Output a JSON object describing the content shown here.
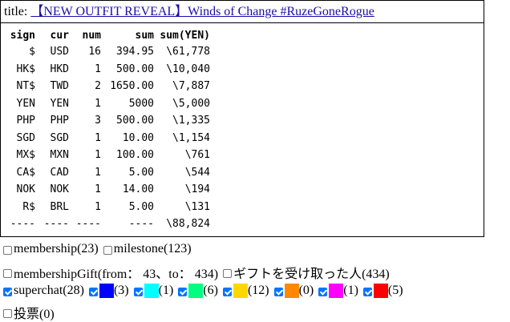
{
  "title": {
    "label": "title:",
    "link_text": "【NEW OUTFIT REVEAL】Winds of Change #RuzeGoneRogue"
  },
  "table": {
    "headers": [
      "sign",
      "cur",
      "num",
      "sum",
      "sum(YEN)"
    ],
    "rows": [
      [
        "$",
        "USD",
        "16",
        "394.95",
        "\\61,778"
      ],
      [
        "HK$",
        "HKD",
        "1",
        "500.00",
        "\\10,040"
      ],
      [
        "NT$",
        "TWD",
        "2",
        "1650.00",
        "\\7,887"
      ],
      [
        "YEN",
        "YEN",
        "1",
        "5000",
        "\\5,000"
      ],
      [
        "PHP",
        "PHP",
        "3",
        "500.00",
        "\\1,335"
      ],
      [
        "SGD",
        "SGD",
        "1",
        "10.00",
        "\\1,154"
      ],
      [
        "MX$",
        "MXN",
        "1",
        "100.00",
        "\\761"
      ],
      [
        "CA$",
        "CAD",
        "1",
        "5.00",
        "\\544"
      ],
      [
        "NOK",
        "NOK",
        "1",
        "14.00",
        "\\194"
      ],
      [
        "R$",
        "BRL",
        "1",
        "5.00",
        "\\131"
      ],
      [
        "----",
        "----",
        "----",
        "----",
        "\\88,824"
      ]
    ]
  },
  "filters": {
    "membership": "membership(23)",
    "milestone": "milestone(123)",
    "membership_gift": "membershipGift(from： 43、to： 434)",
    "gift_received": "ギフトを受け取った人(434)",
    "superchat": "superchat(28)",
    "colors": [
      {
        "color": "#0000ff",
        "count": "(3)"
      },
      {
        "color": "#00ffff",
        "count": "(1)"
      },
      {
        "color": "#00ff80",
        "count": "(6)"
      },
      {
        "color": "#ffd700",
        "count": "(12)"
      },
      {
        "color": "#ff8800",
        "count": "(0)"
      },
      {
        "color": "#ff00ff",
        "count": "(1)"
      },
      {
        "color": "#ff0000",
        "count": "(5)"
      }
    ],
    "vote": "投票(0)"
  }
}
